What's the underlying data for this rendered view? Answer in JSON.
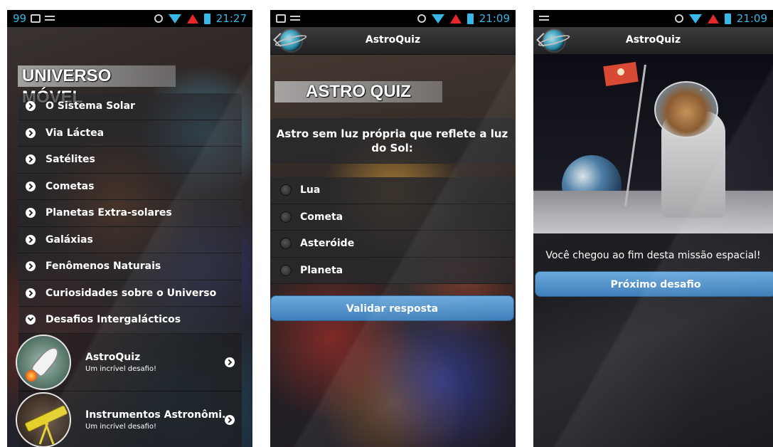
{
  "phone1": {
    "status": {
      "left_number": "99",
      "time": "21:27"
    },
    "app_title": "UNIVERSO MÓVEL",
    "menu": [
      {
        "label": "O Sistema Solar"
      },
      {
        "label": "Via Láctea"
      },
      {
        "label": "Satélites"
      },
      {
        "label": "Cometas"
      },
      {
        "label": "Planetas Extra-solares"
      },
      {
        "label": "Galáxias"
      },
      {
        "label": "Fenômenos Naturais"
      },
      {
        "label": "Curiosidades sobre o Universo"
      },
      {
        "label": "Desafios Intergalácticos",
        "expanded": true
      }
    ],
    "sub_items": [
      {
        "title": "AstroQuiz",
        "description": "Um incrível desafio!",
        "icon": "rocket-icon"
      },
      {
        "title": "Instrumentos Astronômi...",
        "description": "Um incrível desafio!",
        "icon": "telescope-icon"
      }
    ]
  },
  "phone2": {
    "status": {
      "time": "21:09"
    },
    "actionbar_title": "AstroQuiz",
    "quiz_title": "ASTRO QUIZ",
    "question": "Astro sem luz própria que reflete a luz do Sol:",
    "options": [
      "Lua",
      "Cometa",
      "Asteróide",
      "Planeta"
    ],
    "validate_label": "Validar resposta"
  },
  "phone3": {
    "status": {
      "time": "21:09"
    },
    "actionbar_title": "AstroQuiz",
    "end_message": "Você chegou ao fim desta missão espacial!",
    "next_label": "Próximo desafio"
  },
  "colors": {
    "accent_blue": "#39b7e6",
    "button_blue": "#4f8fc8",
    "signal_red": "#e82828"
  }
}
